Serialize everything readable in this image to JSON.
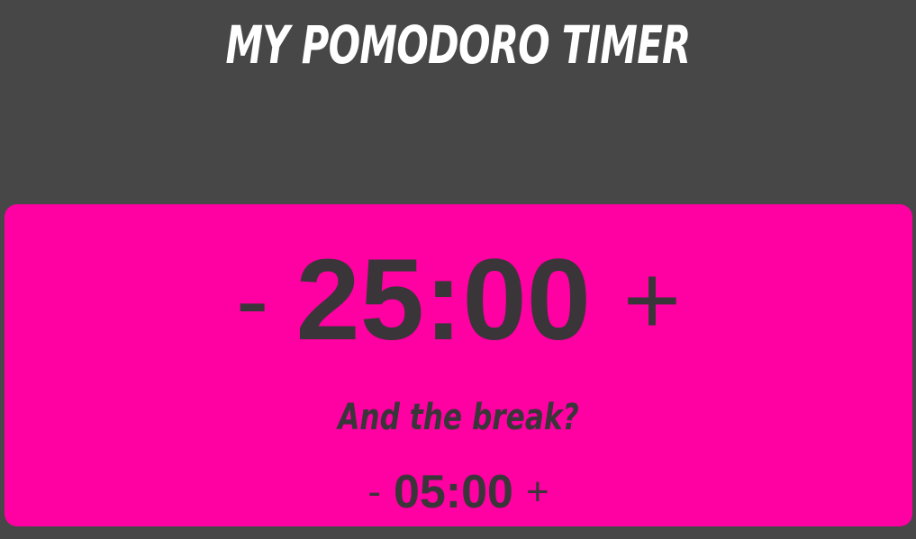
{
  "header": {
    "title": "My Pomodoro Timer"
  },
  "work": {
    "decrement_label": "-",
    "time": "25:00",
    "increment_label": "+"
  },
  "break_section": {
    "label": "And the break?",
    "decrement_label": "-",
    "time": "05:00",
    "increment_label": "+"
  },
  "colors": {
    "background": "#474747",
    "card": "#ff00a2",
    "text_dark": "#3a3539",
    "title_text": "#ffffff"
  }
}
